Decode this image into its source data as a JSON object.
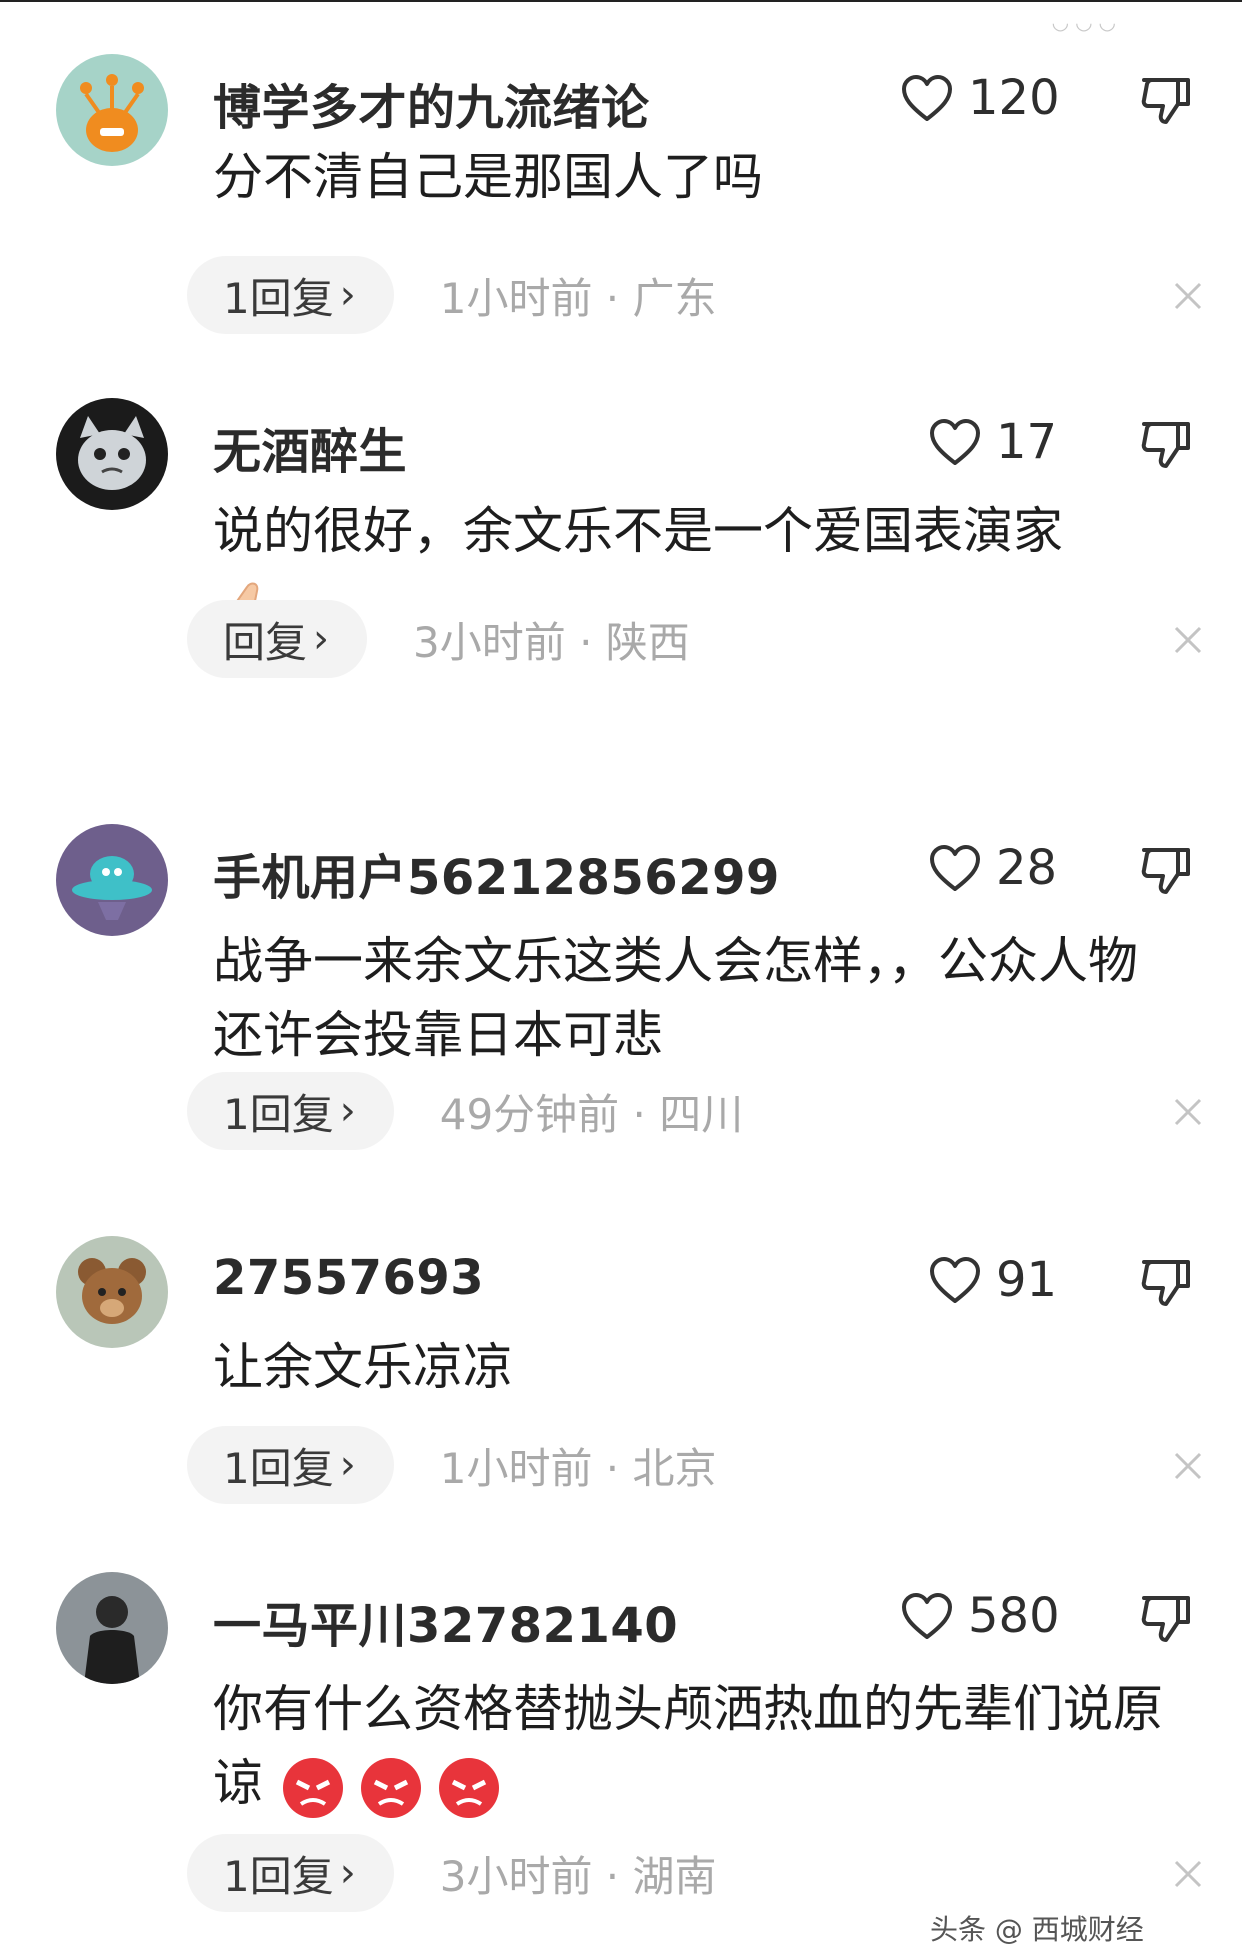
{
  "comments": [
    {
      "username": "博学多才的九流绪论",
      "text": "分不清自己是那国人了吗",
      "likes": "120",
      "reply_label": "1回复",
      "meta": "1小时前 · 广东",
      "avatar_icon": "alien-avatar-icon"
    },
    {
      "username": "无酒醉生",
      "text": "说的很好，余文乐不是一个爱国表演家",
      "emoji": "thumbs-up-icon",
      "likes": "17",
      "reply_label": "回复",
      "meta": "3小时前 · 陕西",
      "avatar_icon": "cat-avatar-icon"
    },
    {
      "username": "手机用户56212856299",
      "text": "战争一来余文乐这类人会怎样，，公众人物还许会投靠日本可悲",
      "likes": "28",
      "reply_label": "1回复",
      "meta": "49分钟前 · 四川",
      "avatar_icon": "ufo-avatar-icon"
    },
    {
      "username": "27557693",
      "text": "让余文乐凉凉",
      "likes": "91",
      "reply_label": "1回复",
      "meta": "1小时前 · 北京",
      "avatar_icon": "teddy-bear-avatar-icon"
    },
    {
      "username": "一马平川32782140",
      "text": "你有什么资格替抛头颅洒热血的先辈们说原谅",
      "emoji": "angry-face-icon",
      "likes": "580",
      "reply_label": "1回复",
      "meta": "3小时前 · 湖南",
      "avatar_icon": "person-photo-avatar-icon"
    }
  ],
  "watermark": "头条 @ 西城财经",
  "colors": {
    "username": "#2b2b2b",
    "meta": "#a9a9a9",
    "reply_bg": "#f3f3f3"
  }
}
